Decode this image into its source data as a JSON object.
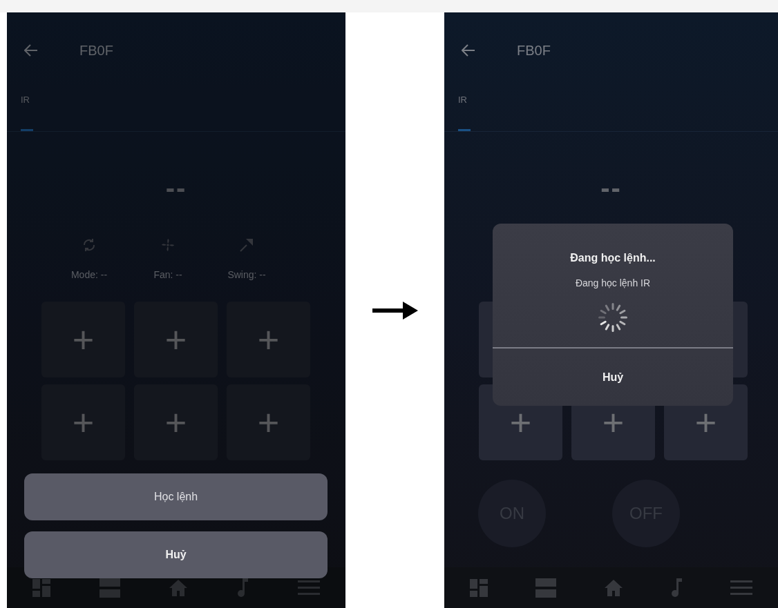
{
  "screens": [
    {
      "title": "FB0F",
      "tabs": [
        {
          "label": "IR",
          "selected": true
        }
      ],
      "temperature": "--",
      "modes": [
        {
          "kind": "mode",
          "label": "Mode: --"
        },
        {
          "kind": "fan",
          "label": "Fan: --"
        },
        {
          "kind": "swing",
          "label": "Swing: --"
        }
      ],
      "keys": [
        {
          "label": "+"
        },
        {
          "label": "+"
        },
        {
          "label": "+"
        },
        {
          "label": "+"
        },
        {
          "label": "+"
        },
        {
          "label": "+"
        }
      ],
      "nav": [
        {
          "kind": "dashboard"
        },
        {
          "kind": "rows"
        },
        {
          "kind": "home"
        },
        {
          "kind": "music"
        },
        {
          "kind": "menu"
        }
      ],
      "action_sheet": [
        {
          "kind": "action",
          "label": "Học lệnh"
        },
        {
          "kind": "cancel",
          "label": "Huỷ"
        }
      ]
    },
    {
      "title": "FB0F",
      "tabs": [
        {
          "label": "IR",
          "selected": true
        }
      ],
      "temperature": "--",
      "keys": [
        {
          "label": "+"
        },
        {
          "label": "+"
        },
        {
          "label": "+"
        }
      ],
      "power": [
        "ON",
        "OFF"
      ],
      "nav": [
        {
          "kind": "dashboard"
        },
        {
          "kind": "rows"
        },
        {
          "kind": "home"
        },
        {
          "kind": "music"
        },
        {
          "kind": "menu"
        }
      ],
      "dialog": {
        "title": "Đang học lệnh...",
        "message": "Đang học lệnh IR",
        "button": "Huỷ"
      }
    }
  ]
}
